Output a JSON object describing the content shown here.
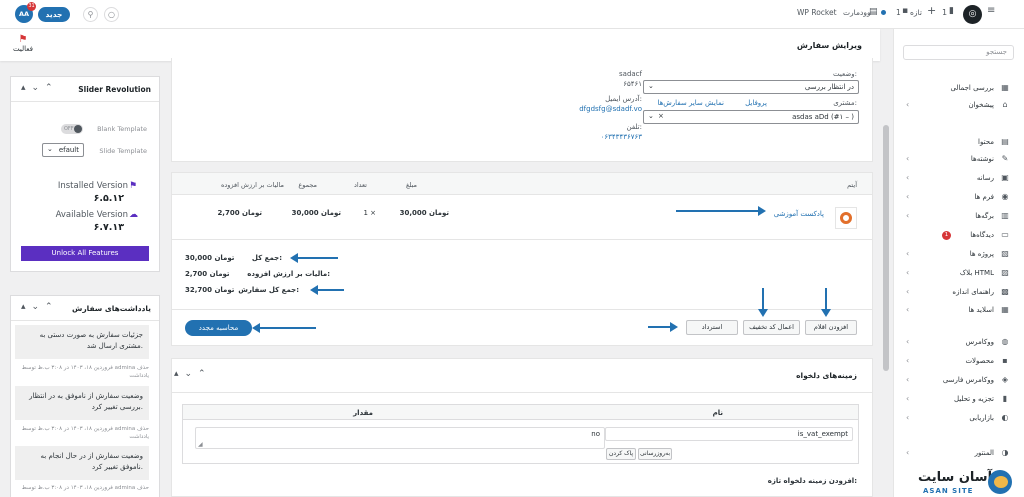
{
  "topbar": {
    "avatar_initials": "AA",
    "badge_count": "31",
    "new_button": "جدید",
    "wp_rocket": "WP Rocket",
    "woodmart": "وودمارت",
    "new_content": "تازه",
    "comments_count": "1"
  },
  "header": {
    "title": "ویرایش سفارش",
    "activity_label": "فعالیت"
  },
  "sidebar": {
    "search_placeholder": "جستجو",
    "items": [
      {
        "label": "بررسی اجمالی",
        "icon": "dashboard-icon",
        "chev": ""
      },
      {
        "label": "پیشخوان",
        "icon": "home-icon",
        "chev": "‹"
      },
      {
        "label": "محتوا",
        "icon": "content-icon",
        "chev": ""
      },
      {
        "label": "نوشته‌ها",
        "icon": "pin-icon",
        "chev": "‹"
      },
      {
        "label": "رسانه",
        "icon": "media-icon",
        "chev": "‹"
      },
      {
        "label": "فرم ها",
        "icon": "form-icon",
        "chev": "‹"
      },
      {
        "label": "برگه‌ها",
        "icon": "page-icon",
        "chev": "‹"
      },
      {
        "label": "دیدگاه‌ها",
        "icon": "comment-icon",
        "chev": ""
      },
      {
        "label": "پروژه ها",
        "icon": "portfolio-icon",
        "chev": "‹"
      },
      {
        "label": "بلاک HTML",
        "icon": "block-icon",
        "chev": "‹"
      },
      {
        "label": "راهنمای اندازه",
        "icon": "ruler-icon",
        "chev": "‹"
      },
      {
        "label": "اسلاید ها",
        "icon": "slides-icon",
        "chev": "‹"
      },
      {
        "label": "ووکامرس",
        "icon": "woo-icon",
        "chev": "‹"
      },
      {
        "label": "محصولات",
        "icon": "products-icon",
        "chev": "‹"
      },
      {
        "label": "ووکامرس فارسی",
        "icon": "woo-fa-icon",
        "chev": "‹"
      },
      {
        "label": "تجزیه و تحلیل",
        "icon": "analytics-icon",
        "chev": "‹"
      },
      {
        "label": "بازاریابی",
        "icon": "marketing-icon",
        "chev": "‹"
      },
      {
        "label": "المنتور",
        "icon": "elementor-icon",
        "chev": "‹"
      }
    ],
    "comments_badge": "1",
    "brand_fa": "آسان سایت",
    "brand_en": "ASAN SITE"
  },
  "slider_revolution": {
    "title": "Slider Revolution",
    "toggle_off": "OFF",
    "blank_template": "Blank Template",
    "default_value": "efault",
    "slide_template": "Slide Template",
    "installed_label": "Installed Version",
    "installed_value": "۶.۵.۱۲",
    "available_label": "Available Version",
    "available_value": "۶.۷.۱۳",
    "unlock_button": "Unlock All Features"
  },
  "order_notes": {
    "title": "یادداشت‌های سفارش",
    "notes": [
      {
        "text": "جزئیات سفارش به صورت دستی به مشتری ارسال شد.",
        "meta": "فروردین ۱۸، ۱۴۰۳ در ۳:۰۸ ب.ظ توسط admina حذف یادداشت"
      },
      {
        "text": "وضعیت سفارش از ناموفق به در انتظار بررسی تغییر کرد.",
        "meta": "فروردین ۱۸، ۱۴۰۳ در ۳:۰۸ ب.ظ توسط admina حذف یادداشت"
      },
      {
        "text": "وضعیت سفارش از در حال انجام به ناموفق تغییر کرد.",
        "meta": "فروردین ۱۸، ۱۴۰۳ در ۳:۰۸ ب.ظ توسط admina حذف"
      }
    ]
  },
  "order_details": {
    "status_label": "وضعیت:",
    "status_value": "در انتظار بررسی",
    "customer_label": "مشتری:",
    "profile_link": "پروفایل",
    "other_orders_link": "نمایش سایر سفارش‌ها",
    "customer_value": "asdas aDd (#۱ – )",
    "clear_x": "×",
    "address_line1": "sadacf",
    "address_line2": "۶۵۴۶۱",
    "email_label": "آدرس ایمیل:",
    "email_value": "dfgdsfg@sdadf.vo",
    "phone_label": "تلفن:",
    "phone_value": "۰۶۳۴۳۴۳۶۷۶۳"
  },
  "items": {
    "headers": {
      "item": "آیتم",
      "cost": "مبلغ",
      "qty": "تعداد",
      "total": "مجموع",
      "vat": "مالیات بر ارزش افزوده"
    },
    "rows": [
      {
        "name": "پادکست آموزشی",
        "cost": "30,000 تومان",
        "qty": "1 ×",
        "total": "30,000 تومان",
        "vat": "2,700 تومان"
      }
    ]
  },
  "totals": {
    "subtotal_label": "جمع کل:",
    "subtotal_value": "30,000 تومان",
    "vat_label": "مالیات بر ارزش افزوده:",
    "vat_value": "2,700 تومان",
    "order_total_label": "جمع کل سفارش:",
    "order_total_value": "32,700 تومان"
  },
  "actions": {
    "add_item": "افزودن اقلام",
    "apply_coupon": "اعمال کد تخفیف",
    "refund": "استرداد",
    "recalculate": "محاسبه مجدد"
  },
  "custom_fields": {
    "title": "زمینه‌های دلخواه",
    "col_name": "نام",
    "col_value": "مقدار",
    "field_name": "is_vat_exempt",
    "field_value": "no",
    "delete_button": "پاک کردن",
    "update_button": "به‌روزرسانی",
    "add_new_label": "افزودن زمینه دلخواه تازه:"
  }
}
